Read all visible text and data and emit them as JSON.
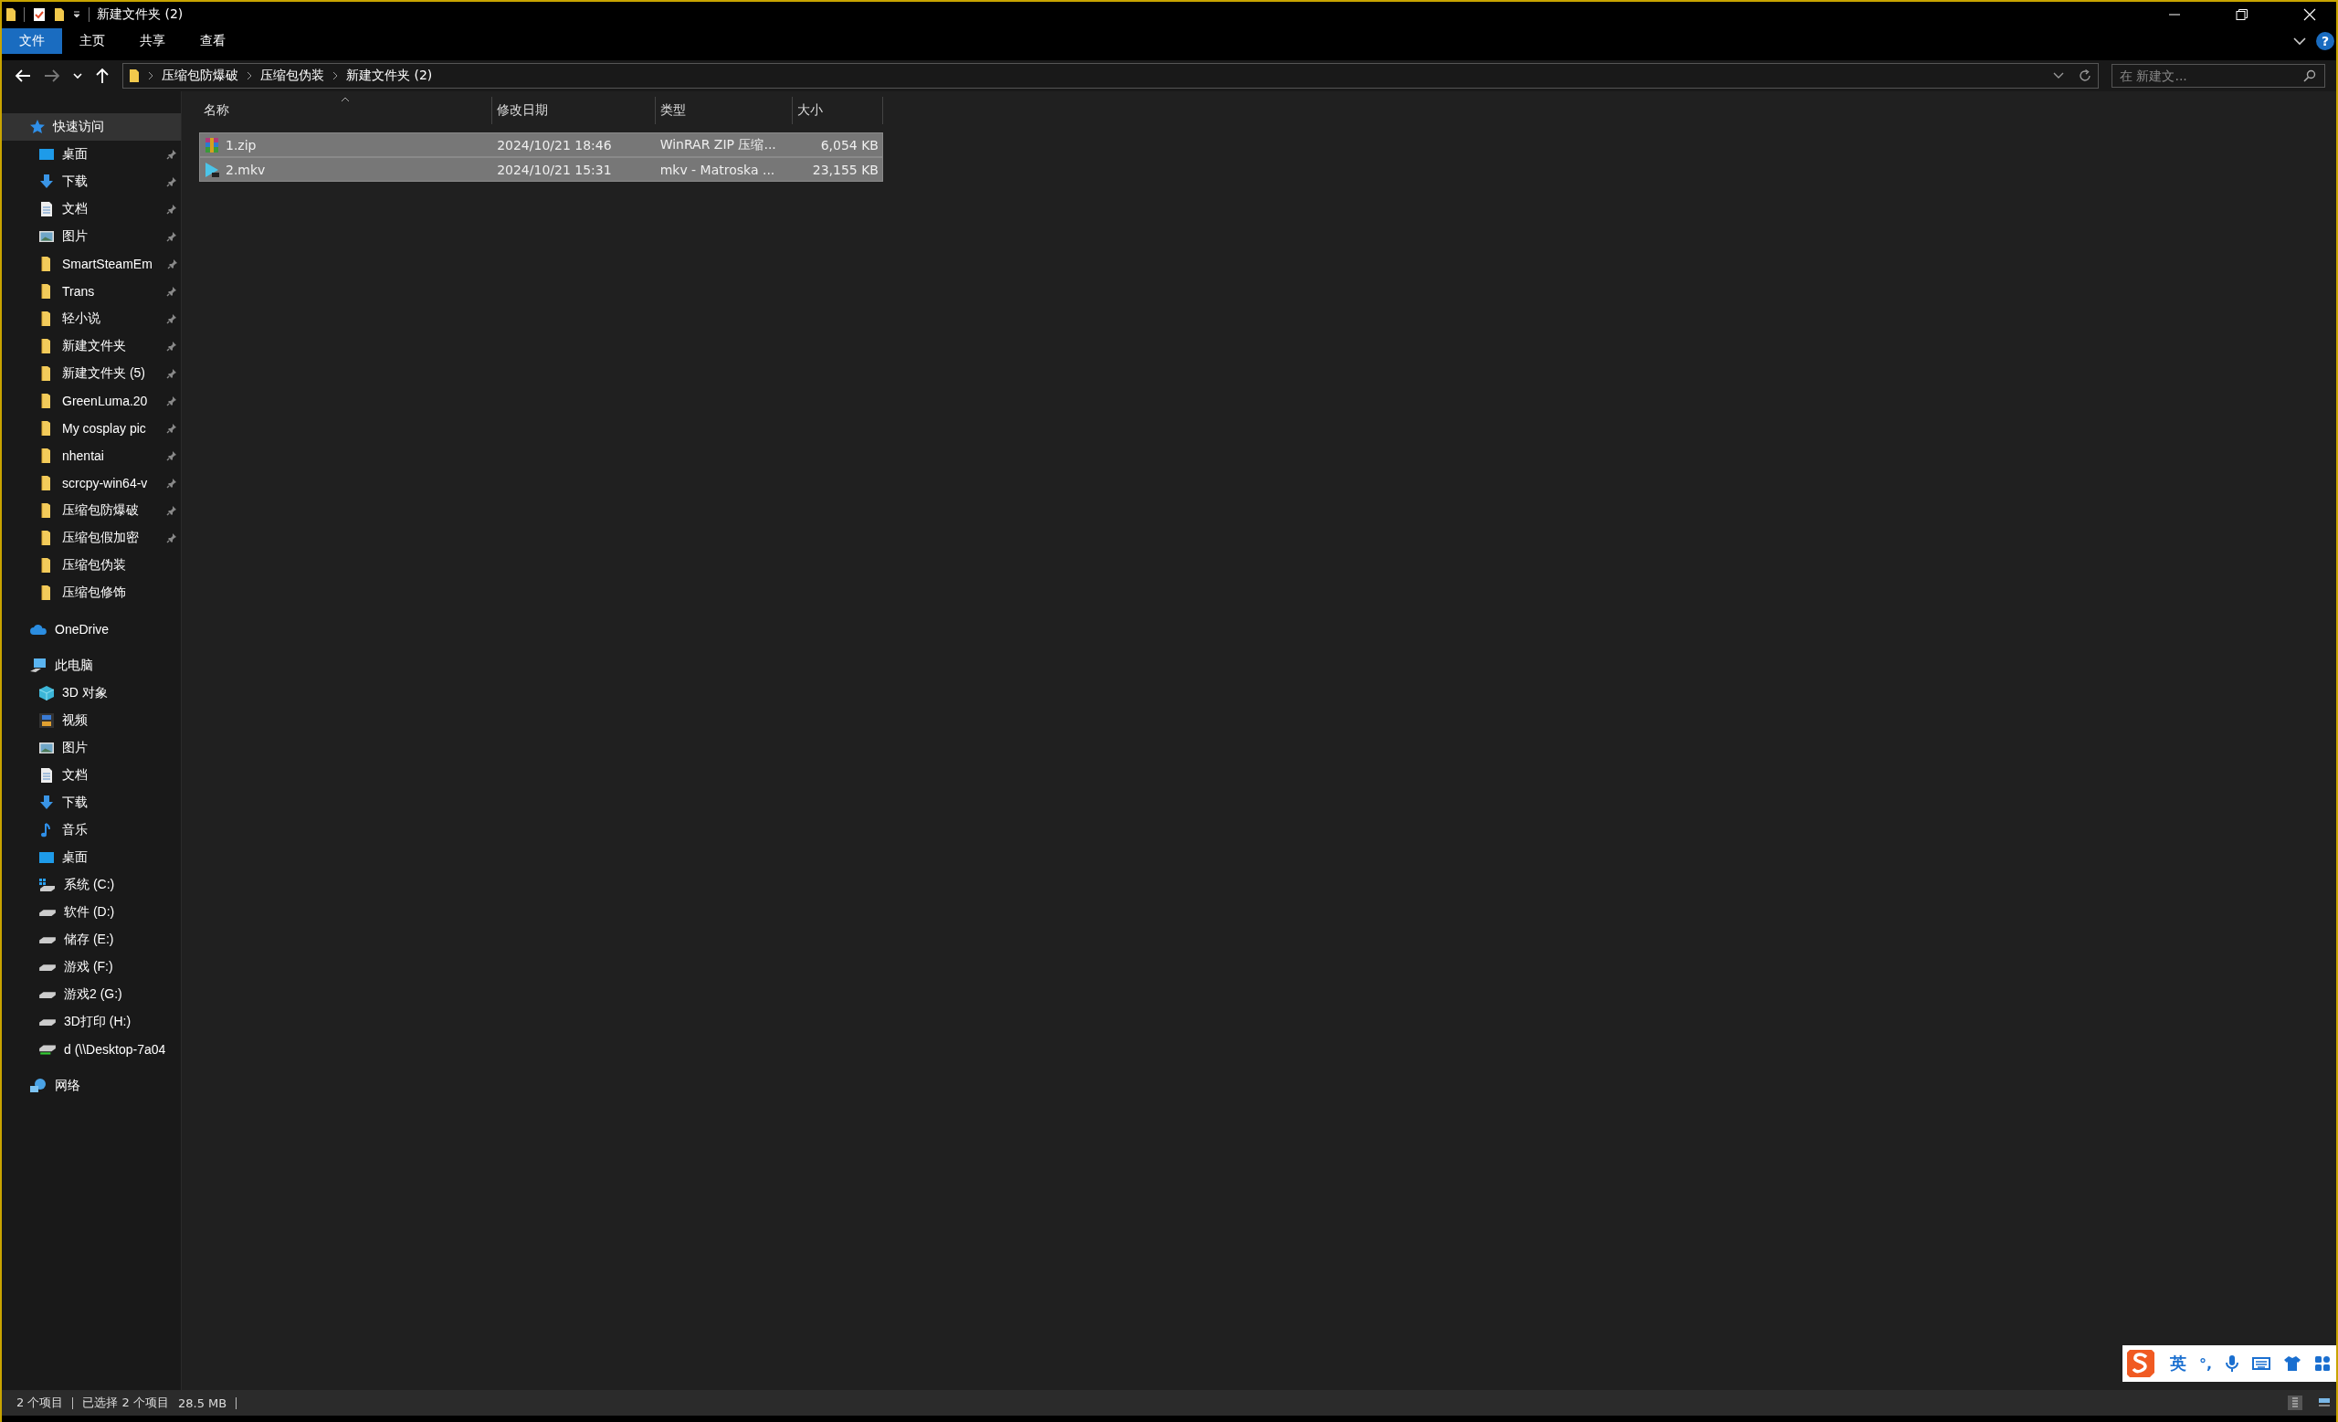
{
  "window": {
    "title": "新建文件夹 (2)"
  },
  "ribbon": {
    "tabs": [
      {
        "label": "文件",
        "selected": true
      },
      {
        "label": "主页",
        "selected": false
      },
      {
        "label": "共享",
        "selected": false
      },
      {
        "label": "查看",
        "selected": false
      }
    ],
    "help": "?"
  },
  "nav_buttons": [
    {
      "kind": "back",
      "disabled": false
    },
    {
      "kind": "forward",
      "disabled": true
    },
    {
      "kind": "recent",
      "disabled": false
    },
    {
      "kind": "up",
      "disabled": false
    }
  ],
  "address": {
    "breadcrumbs": [
      "压缩包防爆破",
      "压缩包伪装",
      "新建文件夹 (2)"
    ]
  },
  "search": {
    "placeholder": "在 新建文..."
  },
  "sidebar": {
    "items": [
      {
        "label": "快速访问",
        "kind": "star",
        "selected": true,
        "children": [
          {
            "label": "桌面",
            "kind": "desktop",
            "pinned": true,
            "selected": false
          },
          {
            "label": "下载",
            "kind": "download",
            "pinned": true,
            "selected": false
          },
          {
            "label": "文档",
            "kind": "document",
            "pinned": true,
            "selected": false
          },
          {
            "label": "图片",
            "kind": "picture",
            "pinned": true,
            "selected": false
          },
          {
            "label": "SmartSteamEm",
            "kind": "folder",
            "pinned": true,
            "selected": false
          },
          {
            "label": "Trans",
            "kind": "folder",
            "pinned": true,
            "selected": false
          },
          {
            "label": "轻小说",
            "kind": "folder",
            "pinned": true,
            "selected": false
          },
          {
            "label": "新建文件夹",
            "kind": "folder",
            "pinned": true,
            "selected": false
          },
          {
            "label": "新建文件夹 (5)",
            "kind": "folder",
            "pinned": true,
            "selected": false
          },
          {
            "label": "GreenLuma.20",
            "kind": "folder",
            "pinned": true,
            "selected": false
          },
          {
            "label": "My cosplay pic",
            "kind": "folder",
            "pinned": true,
            "selected": false
          },
          {
            "label": "nhentai",
            "kind": "folder",
            "pinned": true,
            "selected": false
          },
          {
            "label": "scrcpy-win64-v",
            "kind": "folder",
            "pinned": true,
            "selected": false
          },
          {
            "label": "压缩包防爆破",
            "kind": "folder",
            "pinned": true,
            "selected": false
          },
          {
            "label": "压缩包假加密",
            "kind": "folder",
            "pinned": true,
            "selected": false
          },
          {
            "label": "压缩包伪装",
            "kind": "folder",
            "pinned": false,
            "selected": false
          },
          {
            "label": "压缩包修饰",
            "kind": "folder",
            "pinned": false,
            "selected": false
          }
        ]
      },
      {
        "label": "OneDrive",
        "kind": "cloud",
        "selected": false
      },
      {
        "label": "此电脑",
        "kind": "pc",
        "selected": false,
        "children": [
          {
            "label": "3D 对象",
            "kind": "cube",
            "selected": false
          },
          {
            "label": "视频",
            "kind": "video",
            "selected": false
          },
          {
            "label": "图片",
            "kind": "picture",
            "selected": false
          },
          {
            "label": "文档",
            "kind": "document",
            "selected": false
          },
          {
            "label": "下载",
            "kind": "download",
            "selected": false
          },
          {
            "label": "音乐",
            "kind": "music",
            "selected": false
          },
          {
            "label": "桌面",
            "kind": "desktop",
            "selected": false
          },
          {
            "label": "系统 (C:)",
            "kind": "system-drive",
            "selected": false
          },
          {
            "label": "软件 (D:)",
            "kind": "drive",
            "selected": false
          },
          {
            "label": "储存 (E:)",
            "kind": "drive",
            "selected": false
          },
          {
            "label": "游戏 (F:)",
            "kind": "drive",
            "selected": false
          },
          {
            "label": "游戏2 (G:)",
            "kind": "drive",
            "selected": false
          },
          {
            "label": "3D打印 (H:)",
            "kind": "drive",
            "selected": false
          },
          {
            "label": "d (\\\\Desktop-7a04",
            "kind": "network-drive",
            "selected": false
          }
        ]
      },
      {
        "label": "网络",
        "kind": "network",
        "selected": false
      }
    ]
  },
  "file_list": {
    "columns": [
      {
        "label": "名称",
        "sorted": true
      },
      {
        "label": "修改日期",
        "sorted": false
      },
      {
        "label": "类型",
        "sorted": false
      },
      {
        "label": "大小",
        "sorted": false
      }
    ],
    "rows": [
      {
        "name": "1.zip",
        "kind": "archive",
        "modified": "2024/10/21 18:46",
        "type": "WinRAR ZIP 压缩...",
        "size": "6,054 KB",
        "selected": true
      },
      {
        "name": "2.mkv",
        "kind": "video",
        "modified": "2024/10/21 15:31",
        "type": "mkv - Matroska ...",
        "size": "23,155 KB",
        "selected": true
      }
    ]
  },
  "status_bar": {
    "groups": [
      {
        "texts": [
          "2 个项目"
        ]
      },
      {
        "texts": [
          "已选择 2 个项目",
          "28.5 MB"
        ]
      }
    ],
    "views": [
      {
        "kind": "details",
        "selected": true
      },
      {
        "kind": "tiles",
        "selected": false
      }
    ]
  },
  "ime_toolbar": {
    "mode": "英",
    "punctuation": "°,"
  }
}
